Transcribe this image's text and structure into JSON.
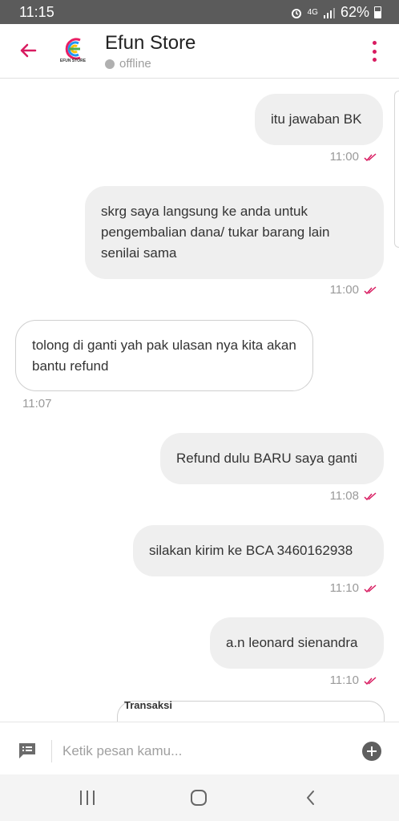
{
  "status_bar": {
    "time": "11:15",
    "network": "4G",
    "battery": "62%"
  },
  "header": {
    "title": "Efun Store",
    "status": "offline",
    "logo_text": "EFUN STORE",
    "accent": "#d81b60"
  },
  "messages": [
    {
      "side": "out",
      "text": "itu jawaban BK",
      "time": "11:00"
    },
    {
      "side": "out",
      "text": "skrg saya langsung ke anda untuk pengembalian dana/ tukar barang lain senilai sama",
      "time": "11:00"
    },
    {
      "side": "in",
      "text": "tolong di ganti yah pak ulasan nya kita akan bantu refund",
      "time": "11:07"
    },
    {
      "side": "out",
      "text": "Refund dulu BARU saya ganti",
      "time": "11:08"
    },
    {
      "side": "out",
      "text": "silakan kirim ke BCA 3460162938",
      "time": "11:10"
    },
    {
      "side": "out",
      "text": "a.n leonard sienandra",
      "time": "11:10"
    }
  ],
  "preview_card": {
    "label": "Transaksi"
  },
  "composer": {
    "placeholder": "Ketik pesan kamu..."
  },
  "icons": {
    "back": "arrow-left-icon",
    "menu": "more-vert-icon",
    "composer": "message-list-icon",
    "add": "add-circle-icon"
  }
}
